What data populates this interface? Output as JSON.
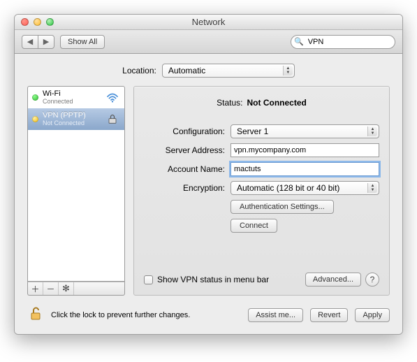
{
  "window": {
    "title": "Network"
  },
  "toolbar": {
    "show_all": "Show All",
    "search_value": "VPN"
  },
  "location": {
    "label": "Location:",
    "value": "Automatic"
  },
  "services": [
    {
      "name": "Wi-Fi",
      "status": "Connected",
      "dot": "green"
    },
    {
      "name": "VPN (PPTP)",
      "status": "Not Connected",
      "dot": "yellow"
    }
  ],
  "detail": {
    "status_label": "Status:",
    "status_value": "Not Connected",
    "config_label": "Configuration:",
    "config_value": "Server 1",
    "server_label": "Server Address:",
    "server_value": "vpn.mycompany.com",
    "account_label": "Account Name:",
    "account_value": "mactuts",
    "encryption_label": "Encryption:",
    "encryption_value": "Automatic (128 bit or 40 bit)",
    "auth_btn": "Authentication Settings...",
    "connect_btn": "Connect",
    "show_status_label": "Show VPN status in menu bar",
    "advanced_btn": "Advanced..."
  },
  "footer": {
    "lock_text": "Click the lock to prevent further changes.",
    "assist": "Assist me...",
    "revert": "Revert",
    "apply": "Apply"
  }
}
